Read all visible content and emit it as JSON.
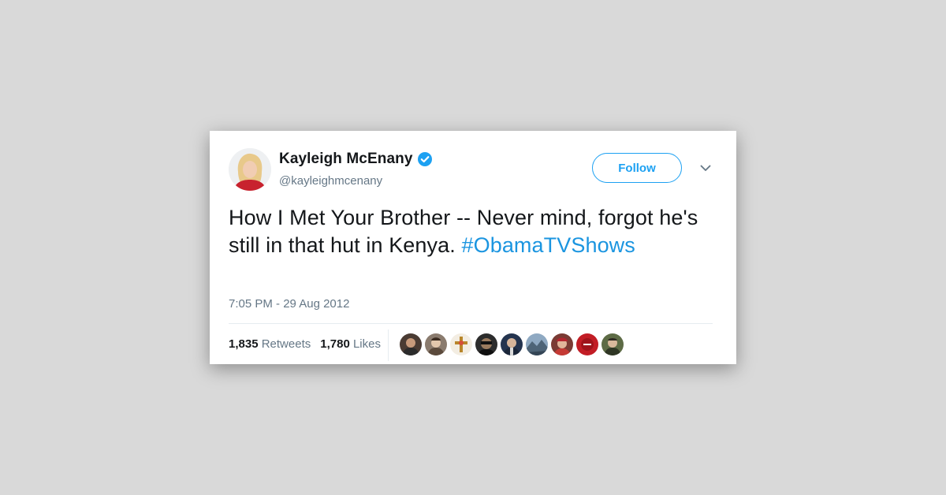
{
  "tweet": {
    "author": {
      "name": "Kayleigh McEnany",
      "handle": "@kayleighmcenany",
      "verified_icon": "verified-badge-icon"
    },
    "follow_label": "Follow",
    "text_line": "How I Met Your Brother -- Never mind, forgot he's still in that hut in Kenya.",
    "hashtag": "#ObamaTVShows",
    "timestamp": "7:05 PM - 29 Aug 2012",
    "stats": {
      "retweets_count": "1,835",
      "retweets_label": "Retweets",
      "likes_count": "1,780",
      "likes_label": "Likes"
    },
    "likers_avatar_count": 9
  },
  "colors": {
    "background": "#d9d9d9",
    "card": "#ffffff",
    "accent": "#1da1f2",
    "hashtag": "#1b95e0",
    "secondary_text": "#657786",
    "primary_text": "#14171a"
  }
}
